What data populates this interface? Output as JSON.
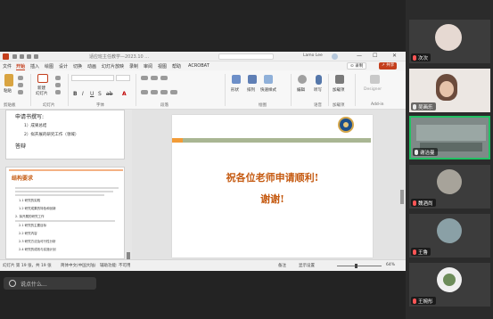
{
  "ppt": {
    "title_bar": {
      "title": "适应班主任教学—2023.10 ...",
      "user": "Lamo Lee",
      "min": "—",
      "max": "☐",
      "close": "✕"
    },
    "menu": [
      "文件",
      "开始",
      "插入",
      "绘图",
      "设计",
      "切换",
      "动画",
      "幻灯片放映",
      "录制",
      "审阅",
      "视图",
      "帮助",
      "ACROBAT"
    ],
    "active_menu": "开始",
    "record_button": "⊙ 录制",
    "share_button": "↗ 共享",
    "ribbon": {
      "paste": "粘贴",
      "new_slide_top": "新建",
      "new_slide_bottom": "幻灯片",
      "shapes": "形状",
      "arrange": "排列",
      "quick_styles": "快速样式",
      "edit": "编辑",
      "dictate": "听写",
      "addins": "加载项",
      "designer": "Designer",
      "font_format_glyphs": [
        "B",
        "I",
        "U",
        "S",
        "ab",
        "A"
      ],
      "groups": [
        "剪贴板",
        "幻灯片",
        "字体",
        "段落",
        "绘图",
        "语音",
        "加载项",
        "Add-in"
      ]
    },
    "outline": {
      "item1": "申请书撰写:",
      "sub1": "1）成果总结",
      "sub2": "2）拟开展的研究工作（领域）",
      "item2": "答辩",
      "struct_title": "结构要求",
      "struct_lines": [
        "1.1 研究的实践",
        "1.2 研究成果的特色和创新",
        "2. 拟开展的研究工作",
        "2.1 研究的主要目标",
        "2.2 研究内容",
        "2.3 研究方法及可行性分析",
        "2.4 研究的成效与实施计划"
      ]
    },
    "slide": {
      "line1": "祝各位老师申请顺利!",
      "line2": "谢谢!"
    },
    "status_bar": {
      "slide_info": "幻灯片 第 19 张，共 19 张",
      "language": "简体中文(中国大陆)",
      "accessibility": "辅助功能: 不可用",
      "notes": "备注",
      "display": "显示设置",
      "zoom": "64%"
    }
  },
  "chat": {
    "placeholder": "说点什么..."
  },
  "participants": [
    {
      "name": "次次",
      "muted": true,
      "avatar_color": "#e6d9d2",
      "active": false
    },
    {
      "name": "吴画乐",
      "muted": false,
      "avatar_color": "#6b4b3c",
      "active": false
    },
    {
      "name": "谢洁曼",
      "muted": false,
      "avatar_color": "#6f7e83",
      "active": true
    },
    {
      "name": "魏酒尚",
      "muted": true,
      "avatar_color": "#a7a39a",
      "active": false
    },
    {
      "name": "王鲁",
      "muted": true,
      "avatar_color": "#8aa0a6",
      "active": false
    },
    {
      "name": "王婉彤",
      "muted": true,
      "avatar_color": "#f0f0f0",
      "active": false
    }
  ]
}
